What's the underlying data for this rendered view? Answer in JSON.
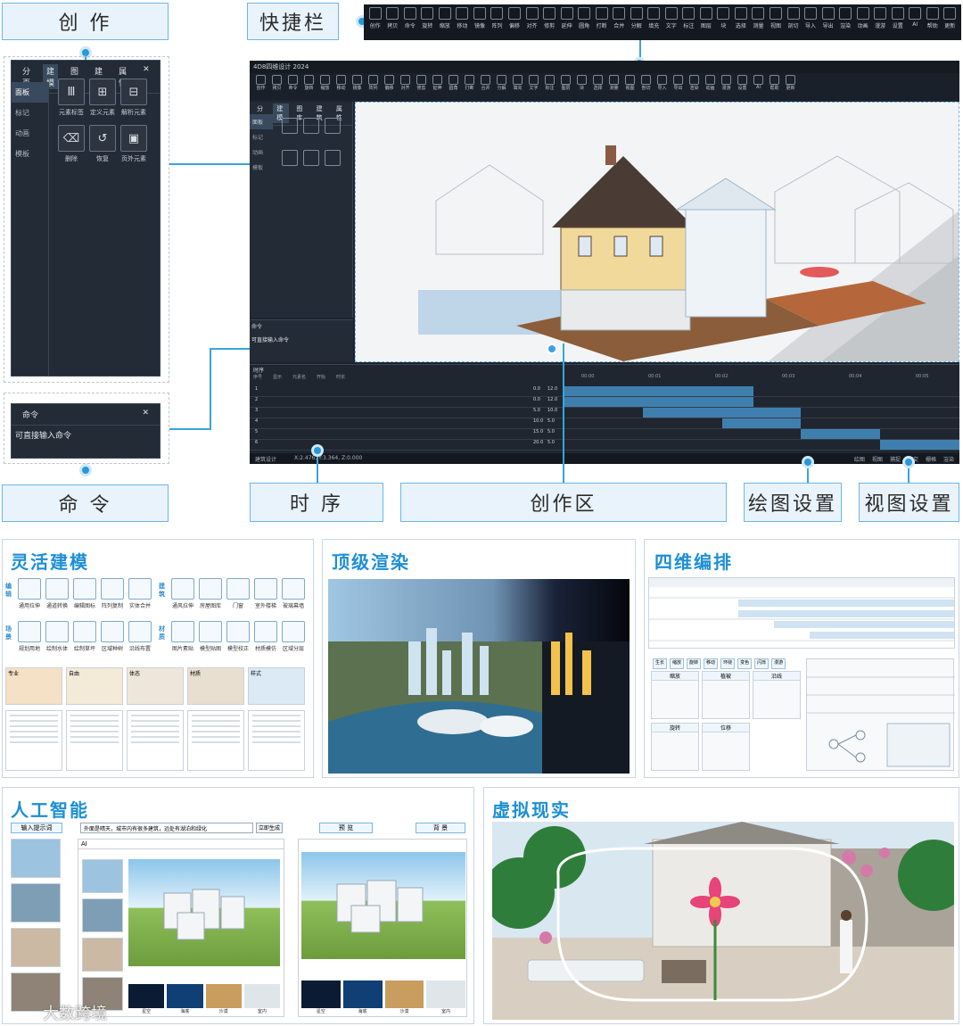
{
  "callouts": {
    "creation": "创 作",
    "quickbar": "快捷栏",
    "command": "命 令",
    "timing": "时 序",
    "creation_area": "创作区",
    "draw_settings": "绘图设置",
    "view_settings": "视图设置"
  },
  "creation_panel": {
    "tabs": [
      "分页",
      "建模",
      "图库",
      "建筑",
      "属性"
    ],
    "close": "✕",
    "side_items": [
      "面板",
      "标记",
      "动画",
      "模板"
    ],
    "tools": [
      {
        "label": "元素标签",
        "icon": "Ⅲ"
      },
      {
        "label": "定义元素",
        "icon": "⊞"
      },
      {
        "label": "解析元素",
        "icon": "⊟"
      },
      {
        "label": "删除",
        "icon": "⌫"
      },
      {
        "label": "恢复",
        "icon": "↺"
      },
      {
        "label": "页外元素",
        "icon": "▣"
      }
    ]
  },
  "command_panel": {
    "title": "命令",
    "close": "✕",
    "text": "可直接输入命令"
  },
  "quickbar": {
    "items": [
      "创作",
      "拷贝",
      "命令",
      "旋转",
      "缩放",
      "移动",
      "镜像",
      "阵列",
      "偏移",
      "对齐",
      "修剪",
      "延伸",
      "圆角",
      "打断",
      "合并",
      "分解",
      "填充",
      "文字",
      "标注",
      "图层",
      "块",
      "选择",
      "测量",
      "视图",
      "剖切",
      "导入",
      "导出",
      "渲染",
      "动画",
      "漫游",
      "设置",
      "AI",
      "帮助",
      "更新"
    ]
  },
  "app": {
    "title": "4D8四维设计 2024",
    "tabs": [
      "分页",
      "建模",
      "图库",
      "建筑",
      "属性"
    ],
    "side": [
      "面板",
      "标记",
      "动画",
      "模板"
    ],
    "command_label": "命令",
    "command_text": "可直接输入命令",
    "timeline_title": "时序",
    "timeline_cols": [
      "序号",
      "显示",
      "元素名",
      "开始",
      "时长"
    ],
    "timeline_times": [
      "00:00",
      "00:01",
      "00:02",
      "00:03",
      "00:04",
      "00:05"
    ],
    "timeline_rows": [
      {
        "idx": "1",
        "start": "0.0",
        "dur": "12.0"
      },
      {
        "idx": "2",
        "start": "0.0",
        "dur": "12.0"
      },
      {
        "idx": "3",
        "start": "5.0",
        "dur": "10.0"
      },
      {
        "idx": "4",
        "start": "10.0",
        "dur": "5.0"
      },
      {
        "idx": "5",
        "start": "15.0",
        "dur": "5.0"
      },
      {
        "idx": "6",
        "start": "20.0",
        "dur": "5.0"
      }
    ],
    "status_left": "建筑设计",
    "status_coords": "X:2.476, Y:3.364, Z:0.000",
    "status_right": [
      "绘图",
      "视图",
      "捕捉",
      "正交",
      "栅格",
      "渲染"
    ]
  },
  "sections": {
    "modeling": {
      "title": "灵活建模",
      "groups": [
        {
          "cat": "编辑",
          "tools": [
            "通用拉伸",
            "通道转换",
            "编辑图标",
            "阵列复制",
            "实体合并"
          ]
        },
        {
          "cat": "建筑",
          "tools": [
            "通风拉伸",
            "房屋图库",
            "门窗",
            "室外楼梯",
            "玻璃幕墙"
          ]
        },
        {
          "cat": "场景",
          "tools": [
            "规划用地",
            "绘制水体",
            "绘制草坪",
            "区域种树",
            "沿线布置"
          ]
        },
        {
          "cat": "材质",
          "tools": [
            "图片素贴",
            "模型贴图",
            "模型校正",
            "材质模仿",
            "区域分层"
          ]
        }
      ],
      "thumbs": [
        "专业",
        "自由",
        "体态",
        "材质",
        "样式"
      ]
    },
    "rendering": {
      "title": "顶级渲染"
    },
    "4d": {
      "title": "四维编排",
      "anim": [
        "缩放",
        "植被",
        "沿线",
        "旋转",
        "位移"
      ],
      "tabs": [
        "生长",
        "缩放",
        "旋转",
        "移动",
        "环绕",
        "变色",
        "闪烁",
        "漫游"
      ]
    },
    "ai": {
      "title": "人工智能",
      "prompt_label": "输入提示词",
      "prompt_text": "外面是晴天，城市内有很多建筑，远处有湖泊和绿化",
      "generate": "立即生成",
      "preview": "预 览",
      "background": "背 景",
      "ai_window": "AI",
      "env_labels": [
        "星空",
        "海底",
        "沙漠",
        "室内"
      ]
    },
    "vr": {
      "title": "虚拟现实"
    }
  },
  "watermark": "大数跨境"
}
